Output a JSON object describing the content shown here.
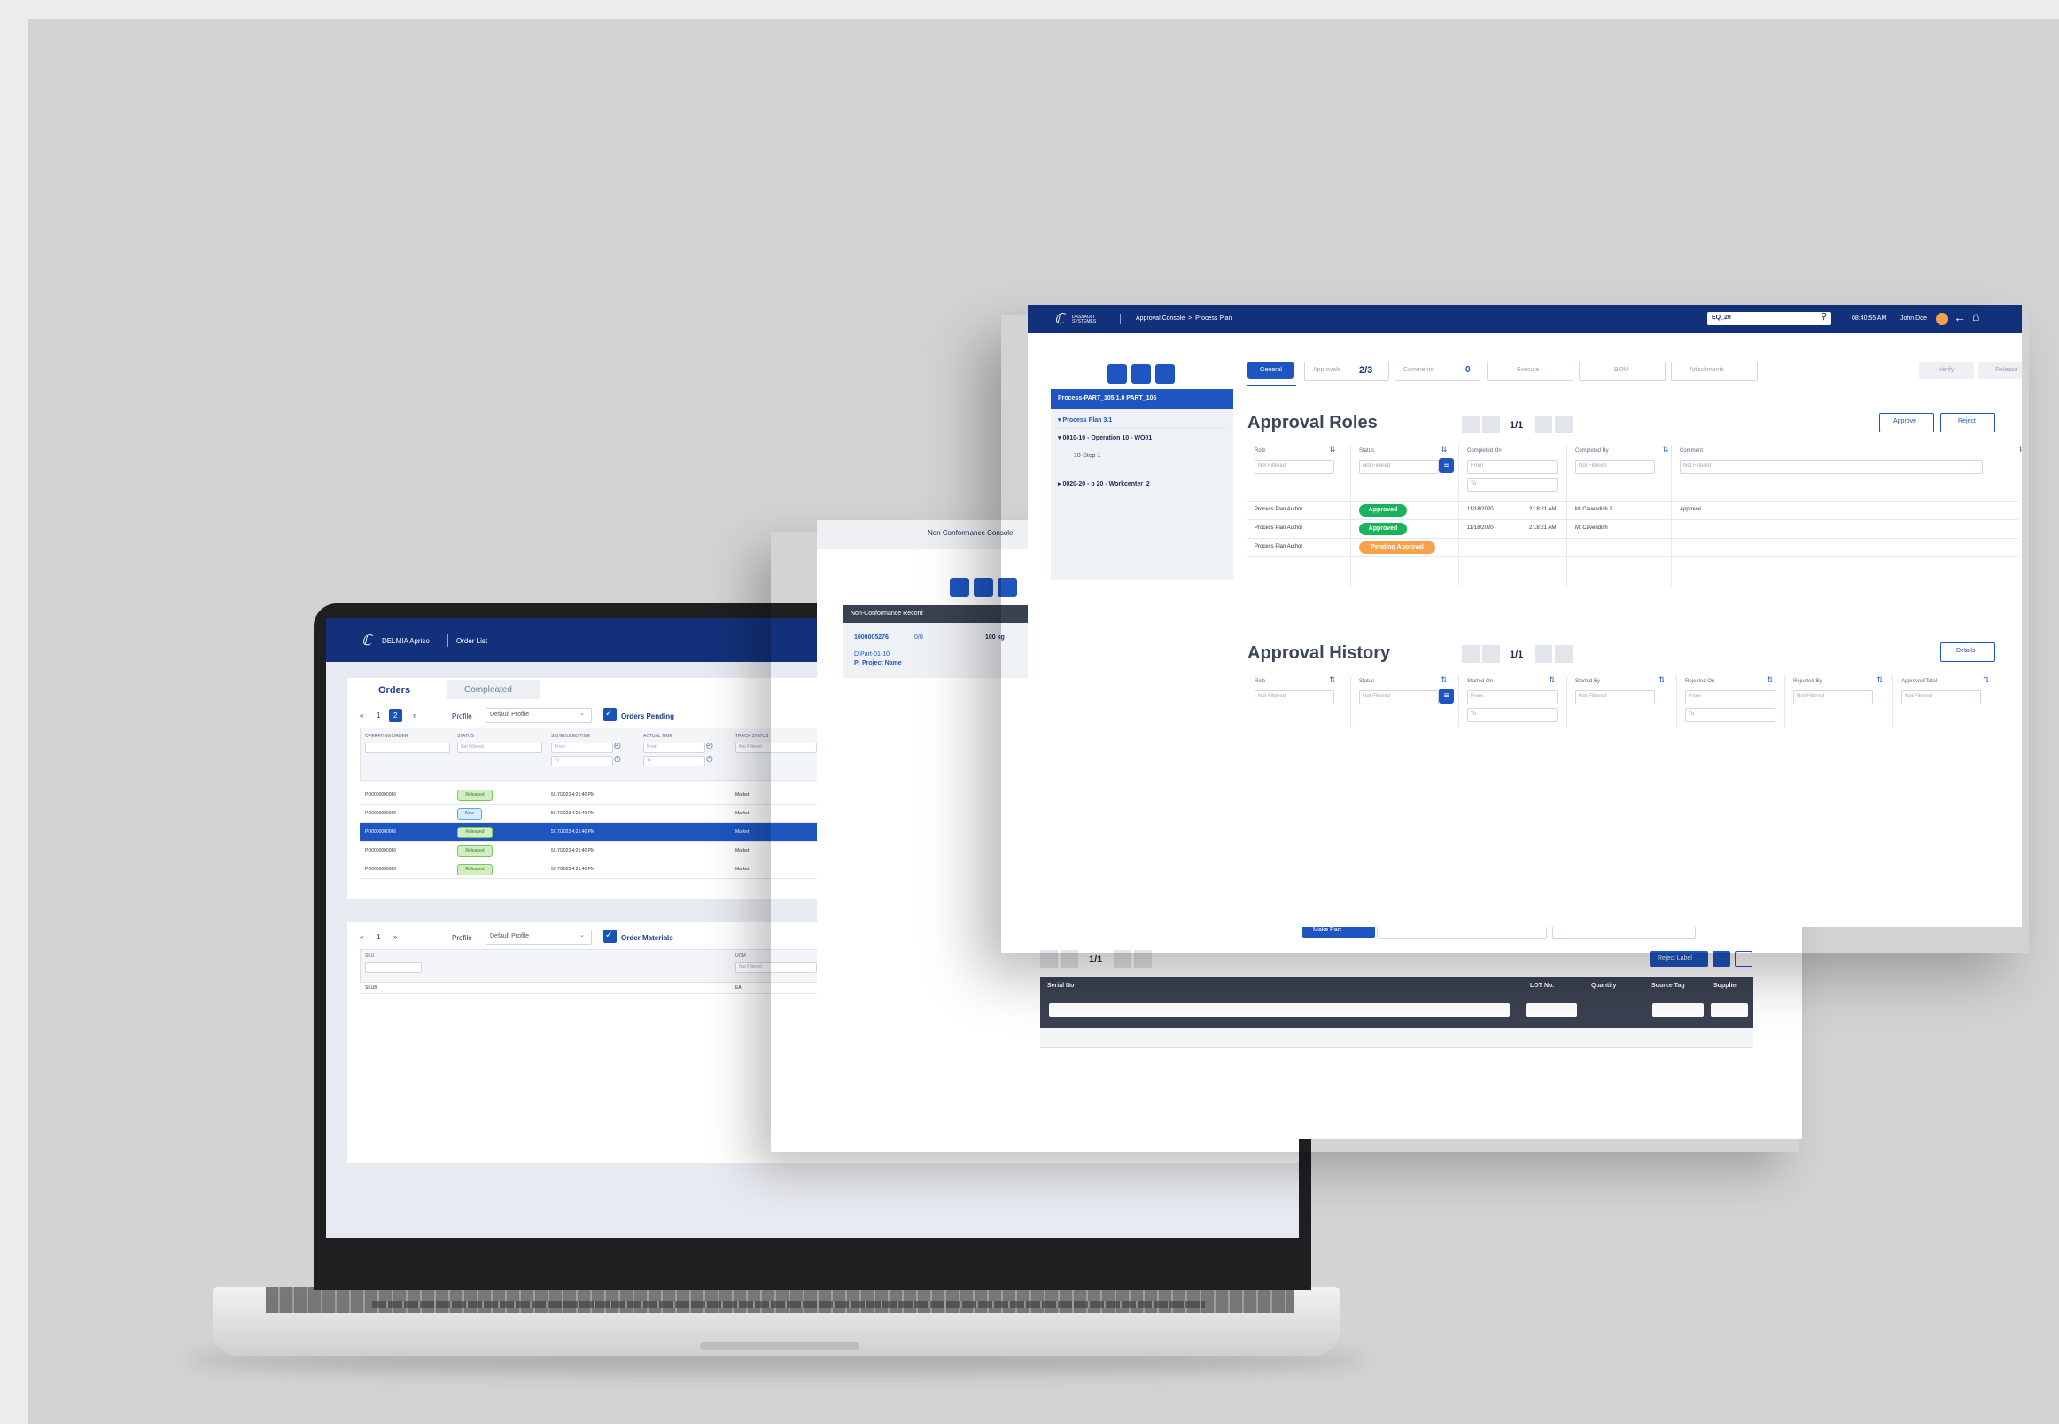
{
  "laptop_app": {
    "brand": "DELMIA Apriso",
    "page_title": "Order List",
    "tabs": [
      "Orders",
      "Compleated"
    ],
    "pager": [
      "«",
      "1",
      "2",
      "»"
    ],
    "profile_label": "Profile",
    "profile_value": "Default Profile",
    "orders_pending_label": "Orders Pending",
    "columns": [
      "OPERATING ORDER",
      "STATUS",
      "SCHEDULED TIME",
      "ACTUAL TIME",
      "TRACK STATUS"
    ],
    "filter_placeholder": "Not Filtered",
    "from_label": "From",
    "to_label": "To",
    "rows": [
      {
        "order": "PO0000000086",
        "status": "Released",
        "time": "5/17/2023 4:21:40 PM",
        "track": "Market"
      },
      {
        "order": "PO0000000086",
        "status": "New",
        "time": "5/17/2023 4:21:40 PM",
        "track": "Market"
      },
      {
        "order": "PO0000000086",
        "status": "Released",
        "time": "5/17/2023 4:21:40 PM",
        "track": "Market"
      },
      {
        "order": "PO0000000086",
        "status": "Released",
        "time": "5/17/2023 4:21:40 PM",
        "track": "Market"
      },
      {
        "order": "PO0000000086",
        "status": "Released",
        "time": "5/17/2023 4:21:40 PM",
        "track": "Market"
      }
    ],
    "pager2": [
      "«",
      "1",
      "»"
    ],
    "order_materials_label": "Order Materials",
    "materials_columns": [
      "SKU",
      "UOM"
    ],
    "materials_row": [
      "SKU8",
      "EA"
    ]
  },
  "nc_console": {
    "title": "Non Conformance Console",
    "record_header": "Non-Conformance Record",
    "record_id": "1000005276",
    "record_count": "0/0",
    "record_weight": "100 kg",
    "part": "D:Part-01-10",
    "project": "P: Project Name",
    "make_part_label": "Make Part",
    "pager": "1/1",
    "reject_label": "Reject Label",
    "columns": [
      "Serial No",
      "LOT No.",
      "Quantity",
      "Source Tag",
      "Supplier"
    ]
  },
  "approval": {
    "brand": "DASSAULT SYSTEMES",
    "breadcrumb": "Approval Console  >  Process Plan",
    "search_value": "EQ_20",
    "time": "08:40:55 AM",
    "user": "John Doe",
    "tree": {
      "root": "Process-PART_105 1.0 PART_105",
      "plan": "▾ Process Plan  3.1",
      "op": "▾ 0010-10 - Operation 10 - WO01",
      "step": "10-Step 1",
      "op2": "▸ 0020-20 - p 20 - Workcenter_2"
    },
    "tabs": {
      "general": "General",
      "approvals": "Approvals",
      "approvals_count": "2/3",
      "comments": "Comments",
      "comments_count": "0",
      "execute": "Execute",
      "bom": "BOM",
      "attachments": "Attachments"
    },
    "verify_label": "Verify",
    "release_label": "Release",
    "roles_title": "Approval Roles",
    "roles_pager": "1/1",
    "approve_label": "Approve",
    "reject_label": "Reject",
    "roles_columns": [
      "Role",
      "Status",
      "Completed On",
      "Completed By",
      "Comment"
    ],
    "filter_placeholder": "Not Filtered",
    "from_label": "From",
    "to_label": "To",
    "roles_rows": [
      {
        "role": "Process Plan Author",
        "status": "Approved",
        "date": "11/18/2020",
        "time": "2:18:21 AM",
        "by": "M. Cavendish 2",
        "comment": "Approval"
      },
      {
        "role": "Process Plan Author",
        "status": "Approved",
        "date": "11/18/2020",
        "time": "2:18:21 AM",
        "by": "M. Cavendish",
        "comment": ""
      },
      {
        "role": "Process Plan Author",
        "status": "Pending Approval",
        "date": "",
        "time": "",
        "by": "",
        "comment": ""
      }
    ],
    "history_title": "Approval History",
    "history_pager": "1/1",
    "details_label": "Details",
    "history_columns": [
      "Role",
      "Status",
      "Started On",
      "Started By",
      "Rejected On",
      "Rejected By",
      "Approved/Total"
    ],
    "colors": {
      "navy": "#13317a",
      "accent": "#1e55c0",
      "approved": "#18b35c",
      "pending": "#f5a24b"
    }
  }
}
